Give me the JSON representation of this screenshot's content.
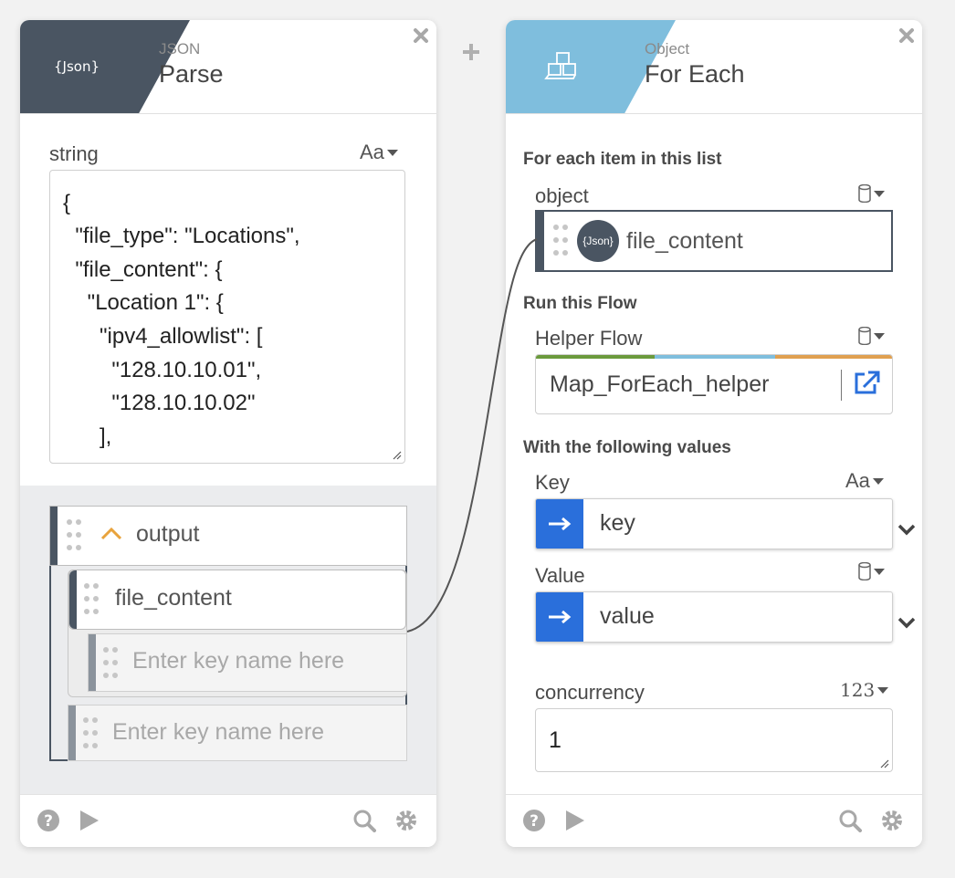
{
  "add_icon": "plus-icon",
  "left_card": {
    "header": {
      "subtitle": "JSON",
      "title": "Parse",
      "icon_label": "{Json}",
      "color": "#4a5562"
    },
    "string_field": {
      "label": "string",
      "type_toggle": "Aa",
      "lines": [
        "{",
        "  \"file_type\": \"Locations\",",
        "  \"file_content\": {",
        "    \"Location 1\": {",
        "      \"ipv4_allowlist\": [",
        "        \"128.10.10.01\",",
        "        \"128.10.10.02\"",
        "      ],"
      ]
    },
    "output_tree": {
      "root_label": "output",
      "child_label": "file_content",
      "placeholder": "Enter key name here",
      "placeholder_2": "Enter key name here"
    }
  },
  "right_card": {
    "header": {
      "subtitle": "Object",
      "title": "For Each",
      "color": "#7fbedd"
    },
    "section_list": "For each item in this list",
    "object_field": {
      "label": "object",
      "chip_label": "file_content",
      "chip_icon_label": "{Json}"
    },
    "section_flow": "Run this Flow",
    "helper_flow": {
      "label": "Helper Flow",
      "value": "Map_ForEach_helper"
    },
    "section_values": "With the following values",
    "key_field": {
      "label": "Key",
      "type_toggle": "Aa",
      "value": "key"
    },
    "value_field": {
      "label": "Value",
      "value": "value"
    },
    "concurrency": {
      "label": "concurrency",
      "type_toggle": "123",
      "value": "1"
    }
  },
  "colors": {
    "accent_blue": "#2a6fdb",
    "flow_bar": [
      "#6b9a3c",
      "#7fbedd",
      "#e0a050"
    ],
    "connector": "#555555",
    "caret_orange": "#e8a33d"
  }
}
